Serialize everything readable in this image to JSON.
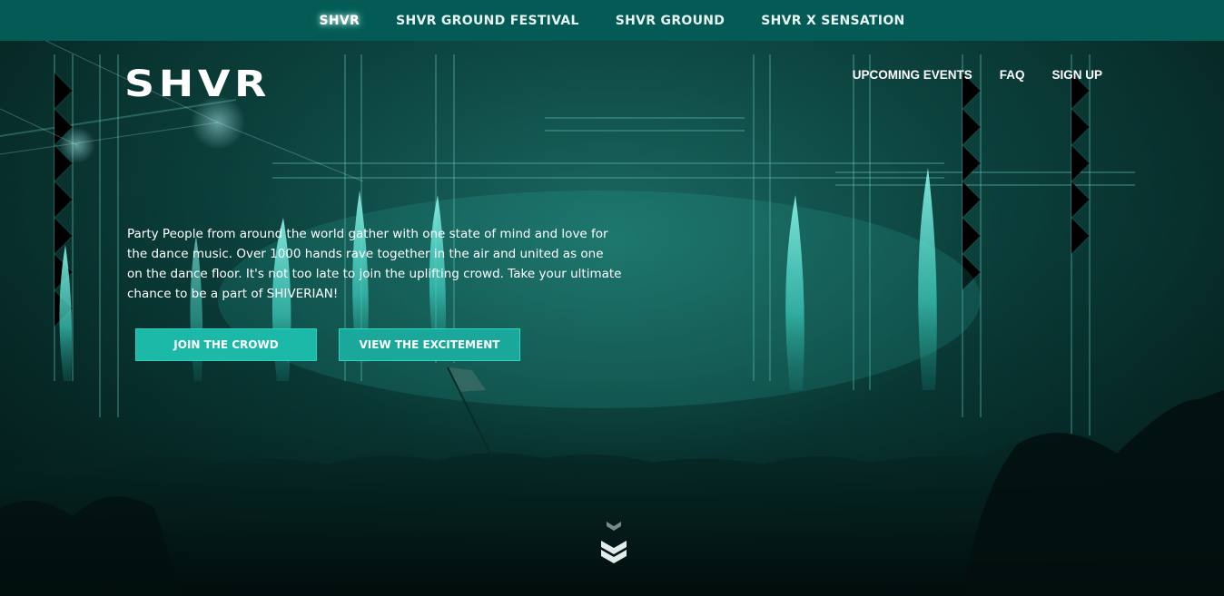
{
  "topbar": {
    "items": [
      {
        "label": "SHVR",
        "active": true
      },
      {
        "label": "SHVR GROUND FESTIVAL",
        "active": false
      },
      {
        "label": "SHVR GROUND",
        "active": false
      },
      {
        "label": "SHVR X SENSATION",
        "active": false
      }
    ]
  },
  "header": {
    "logo": "SHVR",
    "nav": [
      {
        "label": "UPCOMING EVENTS"
      },
      {
        "label": "FAQ"
      },
      {
        "label": "SIGN UP"
      }
    ]
  },
  "hero": {
    "text": "Party People from around the world gather with one state of mind and love for the dance music. Over 1000 hands rave together in the air and united as one on the dance floor. It's not too late to join the uplifting crowd. Take your ultimate chance to be a part of SHIVERIAN!",
    "primary_button": "JOIN THE CROWD",
    "secondary_button": "VIEW THE EXCITEMENT"
  },
  "icons": {
    "scroll": "double-chevron-down-icon"
  },
  "colors": {
    "topbar_bg": "#045a54",
    "accent": "#1cb8a8",
    "text": "#ffffff"
  }
}
